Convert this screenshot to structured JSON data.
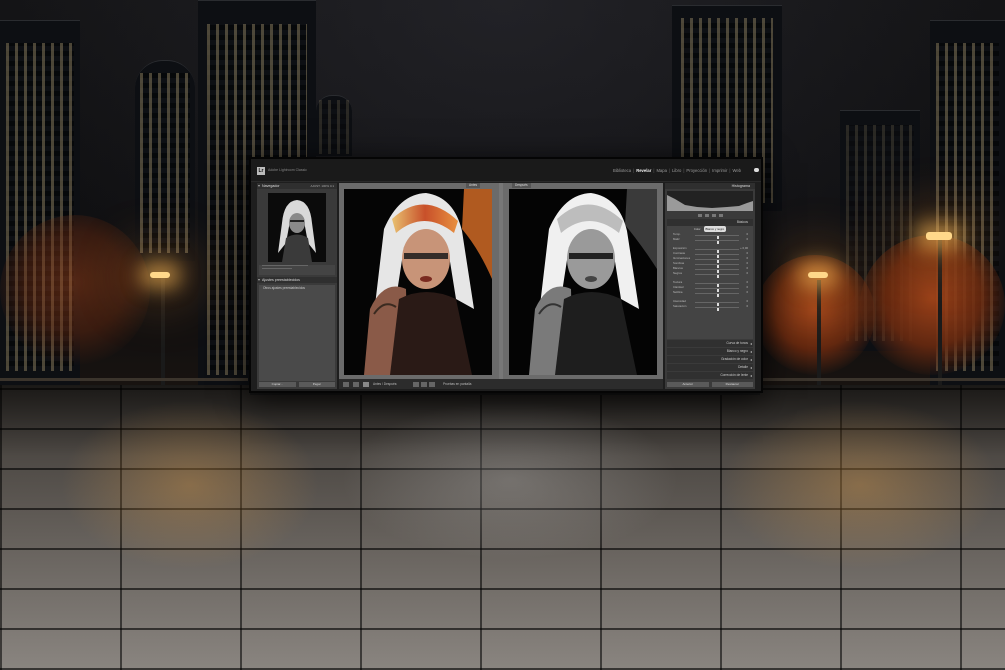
{
  "app": {
    "catalog_name": "Adobe Lightroom Classic",
    "logo_text": "Lr",
    "modules": [
      "Biblioteca",
      "Revelar",
      "Mapa",
      "Libro",
      "Proyección",
      "Imprimir",
      "Web"
    ],
    "active_module": "Revelar"
  },
  "left_panel": {
    "navigator_label": "Navegador",
    "zoom_options": "AJUST.  100%  4:1",
    "presets_label": "Ajustes preestablecidos",
    "preset_item": "Otros ajustes preestablecidos",
    "copy_button": "Copiar...",
    "paste_button": "Pegar"
  },
  "center": {
    "before_label": "Antes",
    "after_label": "Después",
    "view_mode": "Antes / Después:",
    "soft_proof": "Pruebas en pantalla"
  },
  "right_panel": {
    "histogram_label": "Histograma",
    "basic_label": "Básicos",
    "treatment_color": "Color",
    "treatment_bw": "Blanco y negro",
    "rows": [
      {
        "label": "Temp.",
        "value": "0"
      },
      {
        "label": "Matiz",
        "value": "0"
      },
      {
        "label": "Exposición",
        "value": "+ 0,00"
      },
      {
        "label": "Contraste",
        "value": "0"
      },
      {
        "label": "Iluminaciones",
        "value": "0"
      },
      {
        "label": "Sombras",
        "value": "0"
      },
      {
        "label": "Blancos",
        "value": "0"
      },
      {
        "label": "Negros",
        "value": "0"
      },
      {
        "label": "Textura",
        "value": "0"
      },
      {
        "label": "Claridad",
        "value": "0"
      },
      {
        "label": "Neblina",
        "value": "0"
      },
      {
        "label": "Intensidad",
        "value": "0"
      },
      {
        "label": "Saturación",
        "value": "0"
      }
    ],
    "sections": [
      "Curva de tonos",
      "Blanco y negro",
      "Gradación de color",
      "Detalle",
      "Corrección de lente"
    ],
    "previous_button": "Anterior",
    "reset_button": "Restaurar"
  }
}
